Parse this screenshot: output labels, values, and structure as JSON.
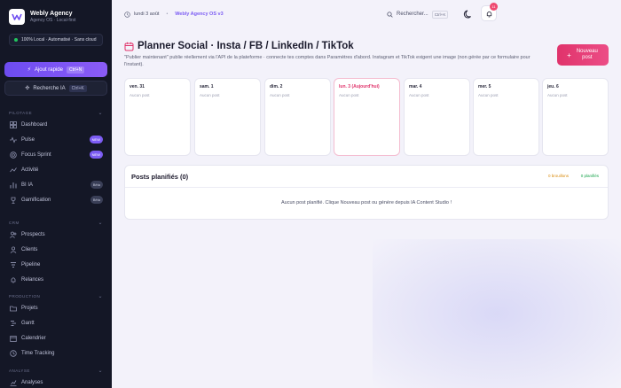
{
  "brand": {
    "name": "Webly Agency",
    "subtitle": "Agency OS · Local-first"
  },
  "local_badge": "100% Local · Automatisé · Sans cloud",
  "quick_add": {
    "label": "Ajout rapide",
    "shortcut": "Ctrl+N"
  },
  "ia_search": {
    "label": "Recherche IA",
    "shortcut": "Ctrl+K"
  },
  "sidebar": {
    "pilotage": {
      "title": "PILOTAGE",
      "items": [
        {
          "label": "Dashboard",
          "icon": "grid-icon"
        },
        {
          "label": "Pulse",
          "icon": "pulse-icon",
          "badge": "NEW"
        },
        {
          "label": "Focus Sprint",
          "icon": "target-icon",
          "badge": "NEW"
        },
        {
          "label": "Activité",
          "icon": "activity-icon"
        },
        {
          "label": "BI IA",
          "icon": "chart-icon",
          "badge": "Bêta"
        },
        {
          "label": "Gamification",
          "icon": "trophy-icon",
          "badge": "Bêta"
        }
      ]
    },
    "crm": {
      "title": "CRM",
      "items": [
        {
          "label": "Prospects",
          "icon": "users-icon"
        },
        {
          "label": "Clients",
          "icon": "user-icon"
        },
        {
          "label": "Pipeline",
          "icon": "pipeline-icon"
        },
        {
          "label": "Relances",
          "icon": "bell-icon"
        }
      ]
    },
    "production": {
      "title": "PRODUCTION",
      "items": [
        {
          "label": "Projets",
          "icon": "folder-icon"
        },
        {
          "label": "Gantt",
          "icon": "gantt-icon"
        },
        {
          "label": "Calendrier",
          "icon": "calendar-icon"
        },
        {
          "label": "Time Tracking",
          "icon": "clock-icon"
        }
      ]
    },
    "analyse": {
      "title": "ANALYSE",
      "items": [
        {
          "label": "Analyses",
          "icon": "analytics-icon"
        }
      ]
    }
  },
  "topbar": {
    "date": "lundi 3 août",
    "os_label": "Webly Agency OS v3",
    "search_label": "Rechercher...",
    "search_shortcut": "Ctrl+K",
    "notifications": "11"
  },
  "page": {
    "title": "Planner Social · Insta / FB / LinkedIn / TikTok",
    "description": "\"Publier maintenant\" publie réellement via l'API de la plateforme · connecte tes comptes dans Paramètres d'abord. Instagram et TikTok exigent une image (non gérée par ce formulaire pour l'instant).",
    "new_post_label": "Nouveau post"
  },
  "days": [
    {
      "label": "ven. 31",
      "empty": "Aucun post"
    },
    {
      "label": "sam. 1",
      "empty": "Aucun post"
    },
    {
      "label": "dim. 2",
      "empty": "Aucun post"
    },
    {
      "label": "lun. 3 (Aujourd'hui)",
      "empty": "Aucun post",
      "today": true
    },
    {
      "label": "mar. 4",
      "empty": "Aucun post"
    },
    {
      "label": "mer. 5",
      "empty": "Aucun post"
    },
    {
      "label": "jeu. 6",
      "empty": "Aucun post"
    }
  ],
  "scheduled": {
    "title": "Posts planifiés (0)",
    "drafts": "0 brouillons",
    "planned": "0 planifiés",
    "empty": "Aucun post planifié. Clique Nouveau post ou génère depuis IA Content Studio !"
  },
  "colors": {
    "accent": "#7c5cf3",
    "primary_cta": "#e0336b",
    "sidebar_bg": "#141726"
  }
}
